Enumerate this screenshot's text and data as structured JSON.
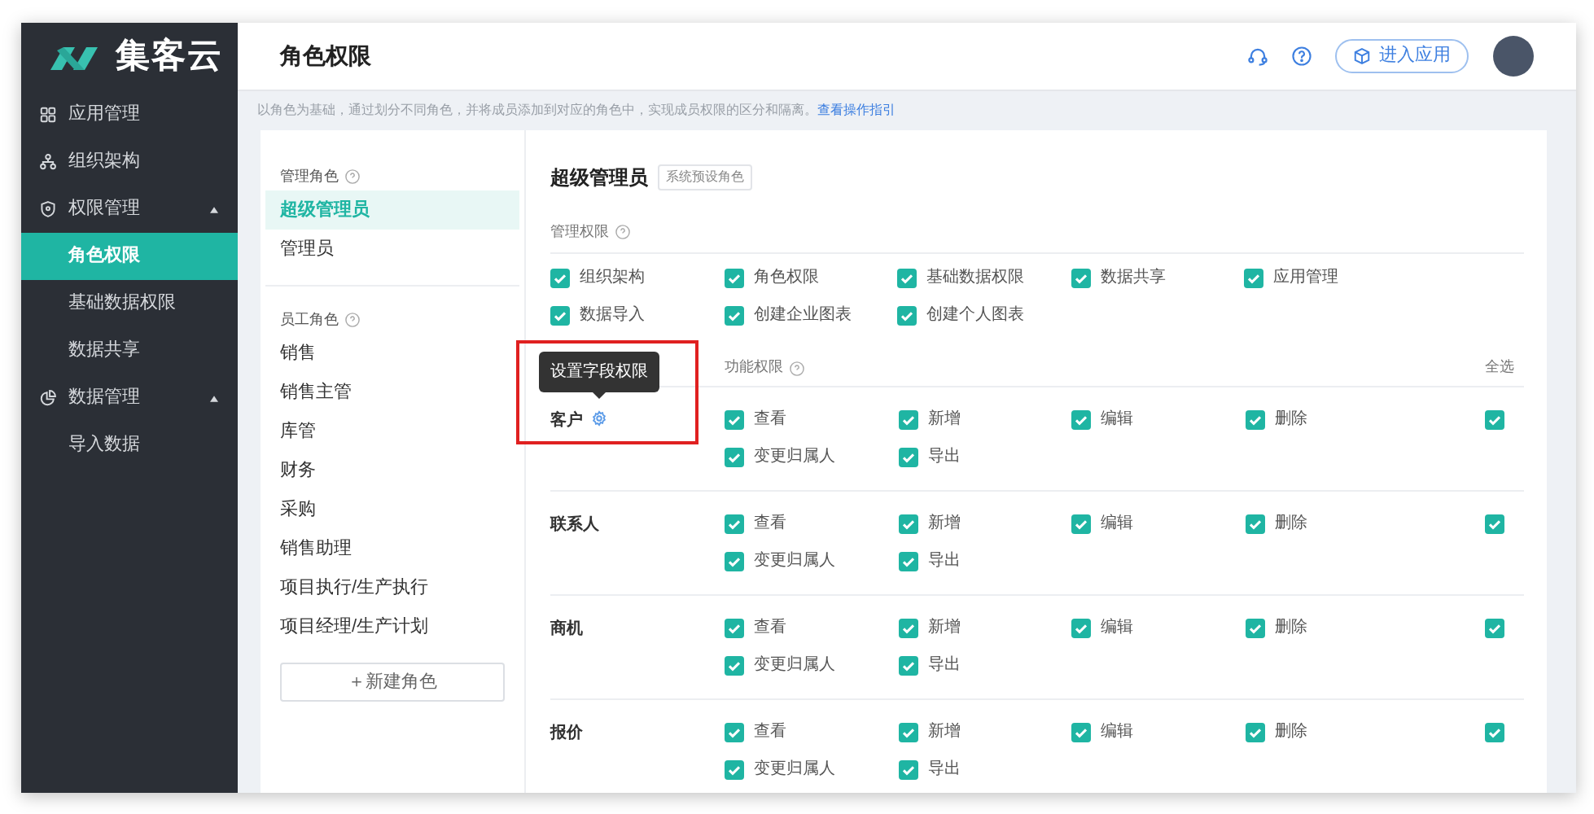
{
  "sidebar": {
    "logo_text": "集客云",
    "items": [
      {
        "kind": "group",
        "label": "应用管理",
        "selected": false
      },
      {
        "kind": "group",
        "label": "组织架构",
        "selected": false
      },
      {
        "kind": "group",
        "label": "权限管理",
        "expanded": true,
        "selected": false
      },
      {
        "kind": "child",
        "label": "角色权限",
        "selected": true
      },
      {
        "kind": "child",
        "label": "基础数据权限",
        "selected": false
      },
      {
        "kind": "child",
        "label": "数据共享",
        "selected": false
      },
      {
        "kind": "group",
        "label": "数据管理",
        "expanded": true,
        "selected": false
      },
      {
        "kind": "child",
        "label": "导入数据",
        "selected": false
      }
    ]
  },
  "header": {
    "title": "角色权限",
    "enter_app_button": "进入应用"
  },
  "description": {
    "text": "以角色为基础，通过划分不同角色，并将成员添加到对应的角色中，实现成员权限的区分和隔离。",
    "link": "查看操作指引"
  },
  "roles": {
    "groups": [
      {
        "title": "管理角色",
        "items": [
          {
            "label": "超级管理员",
            "selected": true
          },
          {
            "label": "管理员",
            "selected": false
          }
        ]
      },
      {
        "title": "员工角色",
        "items": [
          {
            "label": "销售",
            "selected": false
          },
          {
            "label": "销售主管",
            "selected": false
          },
          {
            "label": "库管",
            "selected": false
          },
          {
            "label": "财务",
            "selected": false
          },
          {
            "label": "采购",
            "selected": false
          },
          {
            "label": "销售助理",
            "selected": false
          },
          {
            "label": "项目执行/生产执行",
            "selected": false
          },
          {
            "label": "项目经理/生产计划",
            "selected": false
          }
        ]
      }
    ],
    "new_role_button": "＋新建角色"
  },
  "detail": {
    "role_name": "超级管理员",
    "role_tag": "系统预设角色",
    "admin_section": {
      "title": "管理权限",
      "permissions": [
        {
          "label": "组织架构",
          "checked": true
        },
        {
          "label": "角色权限",
          "checked": true
        },
        {
          "label": "基础数据权限",
          "checked": true
        },
        {
          "label": "数据共享",
          "checked": true
        },
        {
          "label": "应用管理",
          "checked": true
        },
        {
          "label": "数据导入",
          "checked": true
        },
        {
          "label": "创建企业图表",
          "checked": true
        },
        {
          "label": "创建个人图表",
          "checked": true
        }
      ]
    },
    "function_section": {
      "title": "功能权限",
      "select_all_label": "全选",
      "rows": [
        {
          "name": "客户",
          "tooltip": "设置字段权限",
          "select_all": true,
          "permissions": [
            {
              "label": "查看",
              "checked": true
            },
            {
              "label": "新增",
              "checked": true
            },
            {
              "label": "编辑",
              "checked": true
            },
            {
              "label": "删除",
              "checked": true
            },
            {
              "label": "变更归属人",
              "checked": true
            },
            {
              "label": "导出",
              "checked": true
            }
          ]
        },
        {
          "name": "联系人",
          "select_all": true,
          "permissions": [
            {
              "label": "查看",
              "checked": true
            },
            {
              "label": "新增",
              "checked": true
            },
            {
              "label": "编辑",
              "checked": true
            },
            {
              "label": "删除",
              "checked": true
            },
            {
              "label": "变更归属人",
              "checked": true
            },
            {
              "label": "导出",
              "checked": true
            }
          ]
        },
        {
          "name": "商机",
          "select_all": true,
          "permissions": [
            {
              "label": "查看",
              "checked": true
            },
            {
              "label": "新增",
              "checked": true
            },
            {
              "label": "编辑",
              "checked": true
            },
            {
              "label": "删除",
              "checked": true
            },
            {
              "label": "变更归属人",
              "checked": true
            },
            {
              "label": "导出",
              "checked": true
            }
          ]
        },
        {
          "name": "报价",
          "select_all": true,
          "permissions": [
            {
              "label": "查看",
              "checked": true
            },
            {
              "label": "新增",
              "checked": true
            },
            {
              "label": "编辑",
              "checked": true
            },
            {
              "label": "删除",
              "checked": true
            },
            {
              "label": "变更归属人",
              "checked": true
            },
            {
              "label": "导出",
              "checked": true
            }
          ]
        }
      ]
    }
  }
}
